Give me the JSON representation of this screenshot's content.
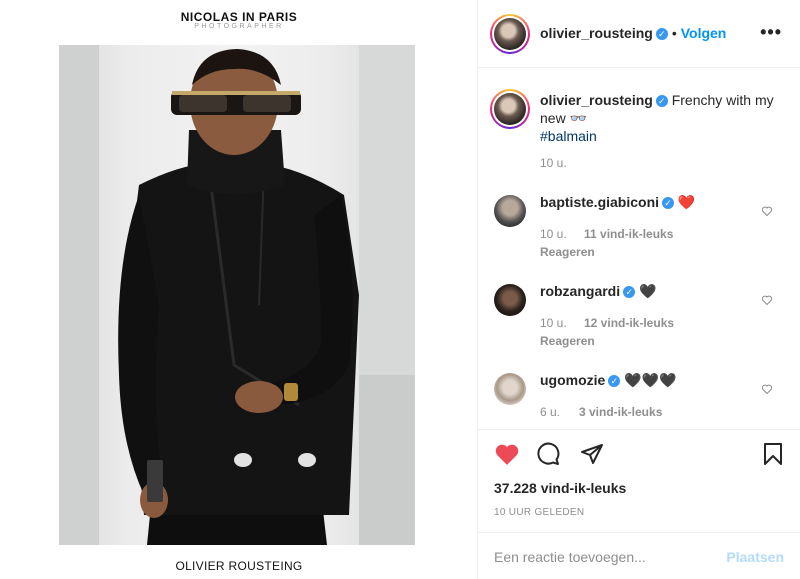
{
  "media": {
    "brand_title": "NICOLAS IN PARIS",
    "brand_subtitle": "PHOTOGRAPHER",
    "caption_name": "OLIVIER ROUSTEING"
  },
  "header": {
    "username": "olivier_rousteing",
    "separator": "•",
    "follow_label": "Volgen",
    "more_label": "•••"
  },
  "caption": {
    "username": "olivier_rousteing",
    "text": "Frenchy with my new 👓",
    "hashtag": "#balmain",
    "time": "10 u."
  },
  "comments": [
    {
      "username": "baptiste.giabiconi",
      "text": "❤️",
      "time": "10 u.",
      "likes": "11 vind-ik-leuks",
      "reply": "Reageren"
    },
    {
      "username": "robzangardi",
      "text": "🖤",
      "time": "10 u.",
      "likes": "12 vind-ik-leuks",
      "reply": "Reageren"
    },
    {
      "username": "ugomozie",
      "text": "🖤🖤🖤",
      "time": "6 u.",
      "likes": "3 vind-ik-leuks"
    }
  ],
  "actions": {
    "likes": "37.228 vind-ik-leuks",
    "timestamp": "10 UUR GELEDEN"
  },
  "add_comment": {
    "placeholder": "Een reactie toevoegen...",
    "post_label": "Plaatsen"
  },
  "icons": {
    "like": "heart-filled-icon",
    "comment": "comment-bubble-icon",
    "share": "paper-plane-icon",
    "save": "bookmark-icon"
  },
  "colors": {
    "like_red": "#ed4956",
    "follow_blue": "#0095f6",
    "verified_blue": "#3897f0",
    "post_disabled": "#b3dbff"
  }
}
